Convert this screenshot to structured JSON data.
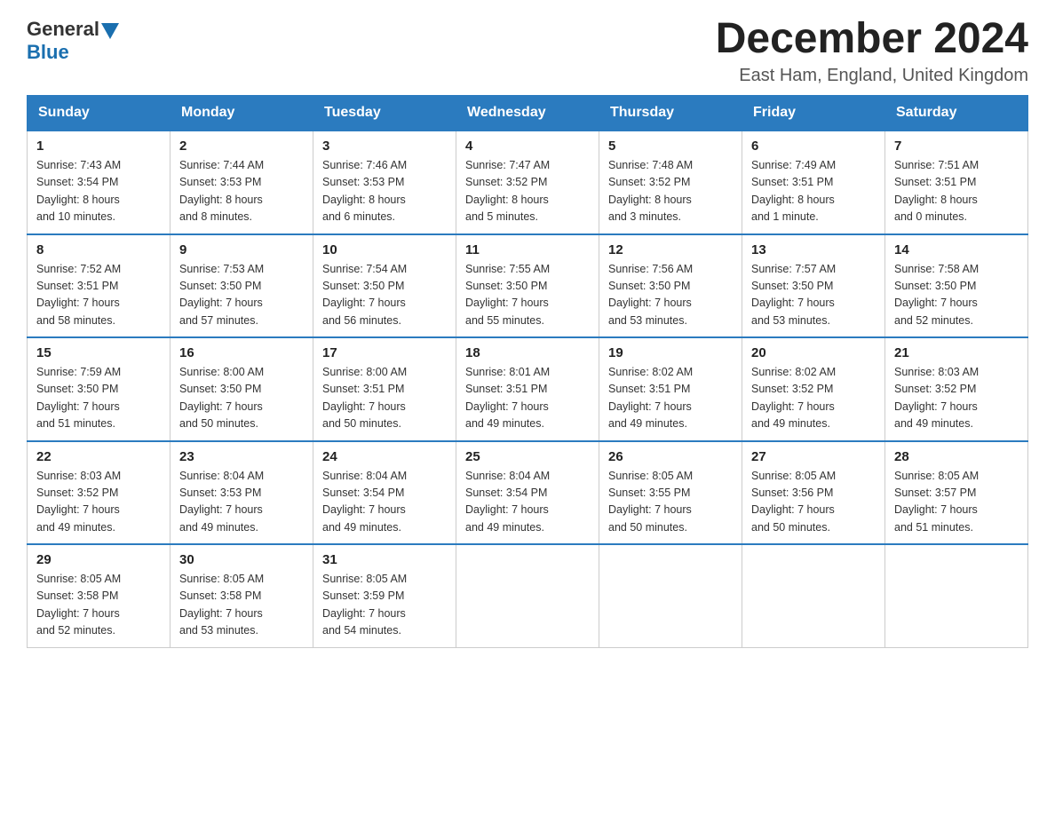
{
  "header": {
    "logo_text1": "General",
    "logo_text2": "Blue",
    "month_title": "December 2024",
    "location": "East Ham, England, United Kingdom"
  },
  "weekdays": [
    "Sunday",
    "Monday",
    "Tuesday",
    "Wednesday",
    "Thursday",
    "Friday",
    "Saturday"
  ],
  "weeks": [
    [
      {
        "day": "1",
        "sunrise": "7:43 AM",
        "sunset": "3:54 PM",
        "daylight": "8 hours and 10 minutes."
      },
      {
        "day": "2",
        "sunrise": "7:44 AM",
        "sunset": "3:53 PM",
        "daylight": "8 hours and 8 minutes."
      },
      {
        "day": "3",
        "sunrise": "7:46 AM",
        "sunset": "3:53 PM",
        "daylight": "8 hours and 6 minutes."
      },
      {
        "day": "4",
        "sunrise": "7:47 AM",
        "sunset": "3:52 PM",
        "daylight": "8 hours and 5 minutes."
      },
      {
        "day": "5",
        "sunrise": "7:48 AM",
        "sunset": "3:52 PM",
        "daylight": "8 hours and 3 minutes."
      },
      {
        "day": "6",
        "sunrise": "7:49 AM",
        "sunset": "3:51 PM",
        "daylight": "8 hours and 1 minute."
      },
      {
        "day": "7",
        "sunrise": "7:51 AM",
        "sunset": "3:51 PM",
        "daylight": "8 hours and 0 minutes."
      }
    ],
    [
      {
        "day": "8",
        "sunrise": "7:52 AM",
        "sunset": "3:51 PM",
        "daylight": "7 hours and 58 minutes."
      },
      {
        "day": "9",
        "sunrise": "7:53 AM",
        "sunset": "3:50 PM",
        "daylight": "7 hours and 57 minutes."
      },
      {
        "day": "10",
        "sunrise": "7:54 AM",
        "sunset": "3:50 PM",
        "daylight": "7 hours and 56 minutes."
      },
      {
        "day": "11",
        "sunrise": "7:55 AM",
        "sunset": "3:50 PM",
        "daylight": "7 hours and 55 minutes."
      },
      {
        "day": "12",
        "sunrise": "7:56 AM",
        "sunset": "3:50 PM",
        "daylight": "7 hours and 53 minutes."
      },
      {
        "day": "13",
        "sunrise": "7:57 AM",
        "sunset": "3:50 PM",
        "daylight": "7 hours and 53 minutes."
      },
      {
        "day": "14",
        "sunrise": "7:58 AM",
        "sunset": "3:50 PM",
        "daylight": "7 hours and 52 minutes."
      }
    ],
    [
      {
        "day": "15",
        "sunrise": "7:59 AM",
        "sunset": "3:50 PM",
        "daylight": "7 hours and 51 minutes."
      },
      {
        "day": "16",
        "sunrise": "8:00 AM",
        "sunset": "3:50 PM",
        "daylight": "7 hours and 50 minutes."
      },
      {
        "day": "17",
        "sunrise": "8:00 AM",
        "sunset": "3:51 PM",
        "daylight": "7 hours and 50 minutes."
      },
      {
        "day": "18",
        "sunrise": "8:01 AM",
        "sunset": "3:51 PM",
        "daylight": "7 hours and 49 minutes."
      },
      {
        "day": "19",
        "sunrise": "8:02 AM",
        "sunset": "3:51 PM",
        "daylight": "7 hours and 49 minutes."
      },
      {
        "day": "20",
        "sunrise": "8:02 AM",
        "sunset": "3:52 PM",
        "daylight": "7 hours and 49 minutes."
      },
      {
        "day": "21",
        "sunrise": "8:03 AM",
        "sunset": "3:52 PM",
        "daylight": "7 hours and 49 minutes."
      }
    ],
    [
      {
        "day": "22",
        "sunrise": "8:03 AM",
        "sunset": "3:52 PM",
        "daylight": "7 hours and 49 minutes."
      },
      {
        "day": "23",
        "sunrise": "8:04 AM",
        "sunset": "3:53 PM",
        "daylight": "7 hours and 49 minutes."
      },
      {
        "day": "24",
        "sunrise": "8:04 AM",
        "sunset": "3:54 PM",
        "daylight": "7 hours and 49 minutes."
      },
      {
        "day": "25",
        "sunrise": "8:04 AM",
        "sunset": "3:54 PM",
        "daylight": "7 hours and 49 minutes."
      },
      {
        "day": "26",
        "sunrise": "8:05 AM",
        "sunset": "3:55 PM",
        "daylight": "7 hours and 50 minutes."
      },
      {
        "day": "27",
        "sunrise": "8:05 AM",
        "sunset": "3:56 PM",
        "daylight": "7 hours and 50 minutes."
      },
      {
        "day": "28",
        "sunrise": "8:05 AM",
        "sunset": "3:57 PM",
        "daylight": "7 hours and 51 minutes."
      }
    ],
    [
      {
        "day": "29",
        "sunrise": "8:05 AM",
        "sunset": "3:58 PM",
        "daylight": "7 hours and 52 minutes."
      },
      {
        "day": "30",
        "sunrise": "8:05 AM",
        "sunset": "3:58 PM",
        "daylight": "7 hours and 53 minutes."
      },
      {
        "day": "31",
        "sunrise": "8:05 AM",
        "sunset": "3:59 PM",
        "daylight": "7 hours and 54 minutes."
      },
      null,
      null,
      null,
      null
    ]
  ],
  "labels": {
    "sunrise": "Sunrise:",
    "sunset": "Sunset:",
    "daylight": "Daylight:"
  }
}
